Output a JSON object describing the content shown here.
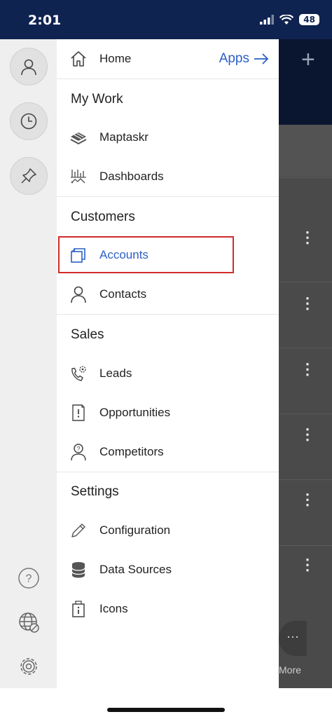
{
  "status_bar": {
    "time": "2:01",
    "battery": "48"
  },
  "drawer": {
    "home": {
      "label": "Home"
    },
    "apps_link": {
      "label": "Apps"
    },
    "sections": {
      "my_work": "My Work",
      "customers": "Customers",
      "sales": "Sales",
      "settings": "Settings"
    },
    "items": {
      "maptaskr": "Maptaskr",
      "dashboards": "Dashboards",
      "accounts": "Accounts",
      "contacts": "Contacts",
      "leads": "Leads",
      "opportunities": "Opportunities",
      "competitors": "Competitors",
      "configuration": "Configuration",
      "data_sources": "Data Sources",
      "icons": "Icons"
    },
    "selected_item": "Accounts"
  },
  "background": {
    "more_label": "More"
  },
  "colors": {
    "accent": "#2b5fc6",
    "status_bar": "#0f2350",
    "highlight": "#d12b2b"
  }
}
